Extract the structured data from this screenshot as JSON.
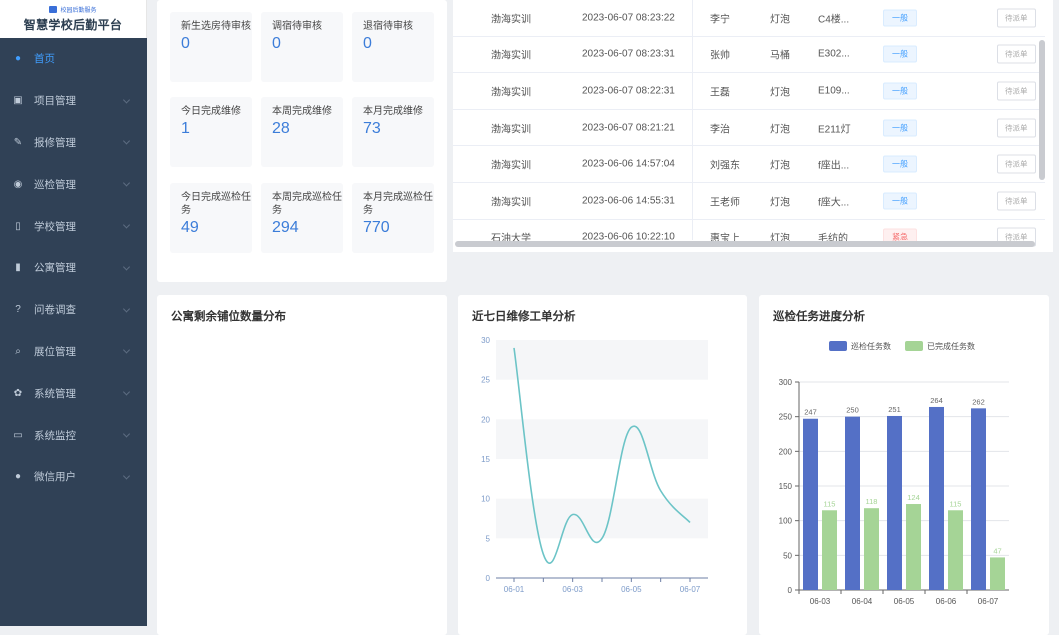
{
  "sidebar": {
    "logo_text": "校园后勤服务",
    "title": "智慧学校后勤平台",
    "items": [
      {
        "label": "首页",
        "icon": "dashboard-icon",
        "active": true
      },
      {
        "label": "项目管理",
        "icon": "project-icon"
      },
      {
        "label": "报修管理",
        "icon": "repair-icon"
      },
      {
        "label": "巡检管理",
        "icon": "eye-icon"
      },
      {
        "label": "学校管理",
        "icon": "book-icon"
      },
      {
        "label": "公寓管理",
        "icon": "bar-chart-icon"
      },
      {
        "label": "问卷调查",
        "icon": "question-icon"
      },
      {
        "label": "展位管理",
        "icon": "search-icon"
      },
      {
        "label": "系统管理",
        "icon": "gear-icon"
      },
      {
        "label": "系统监控",
        "icon": "monitor-icon"
      },
      {
        "label": "微信用户",
        "icon": "wechat-icon"
      }
    ]
  },
  "stats": [
    {
      "label": "新生选房待审核",
      "value": "0"
    },
    {
      "label": "调宿待审核",
      "value": "0"
    },
    {
      "label": "退宿待审核",
      "value": "0"
    },
    {
      "label": "今日完成维修",
      "value": "1"
    },
    {
      "label": "本周完成维修",
      "value": "28"
    },
    {
      "label": "本月完成维修",
      "value": "73"
    },
    {
      "label": "今日完成巡检任务",
      "value": "49"
    },
    {
      "label": "本周完成巡检任务",
      "value": "294"
    },
    {
      "label": "本月完成巡检任务",
      "value": "770"
    }
  ],
  "table": {
    "rows": [
      {
        "school": "渤海实训",
        "time": "2023-06-07 08:23:22",
        "person": "李宁",
        "item": "灯泡",
        "location": "C4楼...",
        "level": "一般",
        "level_type": "normal",
        "action": "待派单"
      },
      {
        "school": "渤海实训",
        "time": "2023-06-07 08:23:31",
        "person": "张帅",
        "item": "马桶",
        "location": "E302...",
        "level": "一般",
        "level_type": "normal",
        "action": "待派单"
      },
      {
        "school": "渤海实训",
        "time": "2023-06-07 08:22:31",
        "person": "王磊",
        "item": "灯泡",
        "location": "E109...",
        "level": "一般",
        "level_type": "normal",
        "action": "待派单"
      },
      {
        "school": "渤海实训",
        "time": "2023-06-07 08:21:21",
        "person": "李治",
        "item": "灯泡",
        "location": "E211灯",
        "level": "一般",
        "level_type": "normal",
        "action": "待派单"
      },
      {
        "school": "渤海实训",
        "time": "2023-06-06 14:57:04",
        "person": "刘强东",
        "item": "灯泡",
        "location": "f座出...",
        "level": "一般",
        "level_type": "normal",
        "action": "待派单"
      },
      {
        "school": "渤海实训",
        "time": "2023-06-06 14:55:31",
        "person": "王老师",
        "item": "灯泡",
        "location": "f座大...",
        "level": "一般",
        "level_type": "normal",
        "action": "待派单"
      },
      {
        "school": "石油大学",
        "time": "2023-06-06 10:22:10",
        "person": "惠宝上",
        "item": "灯泡",
        "location": "毛纺的",
        "level": "紧急",
        "level_type": "urgent",
        "action": "待派单"
      }
    ]
  },
  "panels": {
    "apartment_title": "公寓剩余铺位数量分布",
    "repair_title": "近七日维修工单分析",
    "inspection_title": "巡检任务进度分析"
  },
  "chart_data": [
    {
      "type": "line",
      "title": "近七日维修工单分析",
      "x_ticks": [
        "06-01",
        "06-03",
        "06-05",
        "06-07"
      ],
      "x": [
        "06-01",
        "06-02",
        "06-03",
        "06-04",
        "06-05",
        "06-06",
        "06-07"
      ],
      "values": [
        29,
        3,
        8,
        5,
        19,
        11,
        7
      ],
      "ylim": [
        0,
        30
      ],
      "y_ticks": [
        0,
        5,
        10,
        15,
        20,
        25,
        30
      ],
      "color": "#6cc4c7"
    },
    {
      "type": "bar",
      "title": "巡检任务进度分析",
      "categories": [
        "06-03",
        "06-04",
        "06-05",
        "06-06",
        "06-07"
      ],
      "series": [
        {
          "name": "巡检任务数",
          "values": [
            247,
            250,
            251,
            264,
            262
          ],
          "color": "#5470c6"
        },
        {
          "name": "已完成任务数",
          "values": [
            115,
            118,
            124,
            115,
            47
          ],
          "color": "#a5d496"
        }
      ],
      "ylim": [
        0,
        300
      ],
      "y_ticks": [
        0,
        50,
        100,
        150,
        200,
        250,
        300
      ],
      "legend": "top-center"
    }
  ]
}
